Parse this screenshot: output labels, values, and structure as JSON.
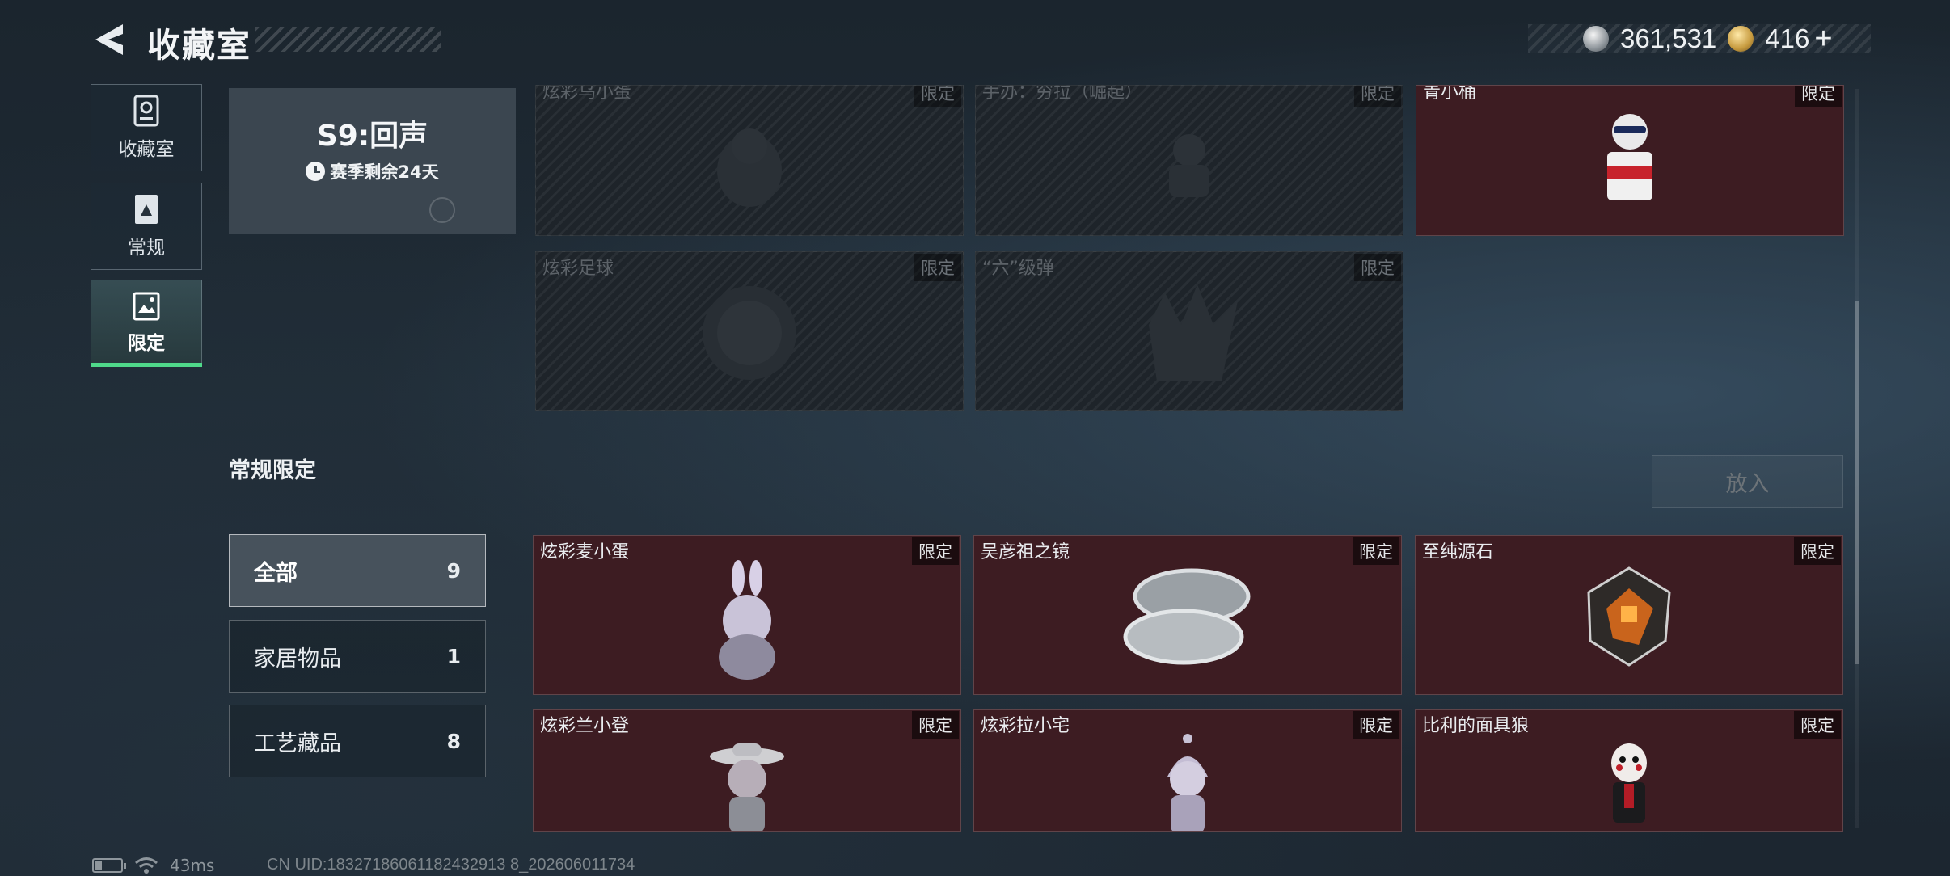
{
  "header": {
    "title": "收藏室",
    "silver_value": "361,531",
    "gold_value": "416",
    "plus_label": "+"
  },
  "nav": {
    "items": [
      {
        "label": "收藏室"
      },
      {
        "label": "常规"
      },
      {
        "label": "限定"
      }
    ]
  },
  "season": {
    "title": "S9:回声",
    "remaining": "赛季剩余24天"
  },
  "top_cards": [
    {
      "name": "炫彩乌小蛋",
      "tag": "限定"
    },
    {
      "name": "手办：穷拉（崛起）",
      "tag": "限定"
    },
    {
      "name": "青小桶",
      "tag": "限定"
    },
    {
      "name": "炫彩足球",
      "tag": "限定"
    },
    {
      "name": "“六”级弹",
      "tag": "限定"
    }
  ],
  "section": {
    "title": "常规限定",
    "place_button": "放入"
  },
  "filters": [
    {
      "label": "全部",
      "count": "9"
    },
    {
      "label": "家居物品",
      "count": "1"
    },
    {
      "label": "工艺藏品",
      "count": "8"
    }
  ],
  "items": [
    {
      "name": "炫彩麦小蛋",
      "tag": "限定"
    },
    {
      "name": "吴彦祖之镜",
      "tag": "限定"
    },
    {
      "name": "至纯源石",
      "tag": "限定"
    },
    {
      "name": "炫彩兰小登",
      "tag": "限定"
    },
    {
      "name": "炫彩拉小宅",
      "tag": "限定"
    },
    {
      "name": "比利的面具狼",
      "tag": "限定"
    }
  ],
  "status_bar": {
    "ping": "43ms",
    "uid": "CN UID:18327186061182432913 8_202606011734"
  }
}
